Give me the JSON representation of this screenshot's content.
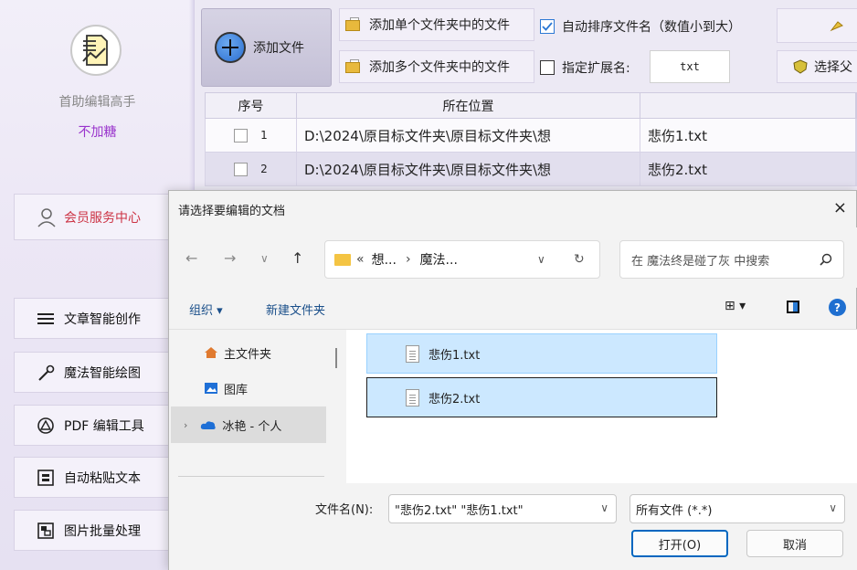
{
  "sidebar": {
    "app_name": "首助编辑高手",
    "app_subtitle": "不加糖",
    "member_center": "会员服务中心",
    "nav": [
      {
        "label": "文章智能创作",
        "icon": "menu-lines-icon"
      },
      {
        "label": "魔法智能绘图",
        "icon": "magic-wand-icon"
      },
      {
        "label": "PDF 编辑工具",
        "icon": "pdf-icon"
      },
      {
        "label": "自动粘贴文本",
        "icon": "paste-icon"
      },
      {
        "label": "图片批量处理",
        "icon": "image-icon"
      }
    ]
  },
  "toolbar": {
    "add_file": "添加文件",
    "add_single_folder": "添加单个文件夹中的文件",
    "add_multi_folder": "添加多个文件夹中的文件",
    "auto_sort": "自动排序文件名（数值小到大）",
    "auto_sort_checked": true,
    "specify_ext": "指定扩展名:",
    "specify_ext_checked": false,
    "ext_value": "txt",
    "select_parent": "选择父"
  },
  "table": {
    "headers": [
      "序号",
      "所在位置",
      ""
    ],
    "rows": [
      {
        "index": "1",
        "location": "D:\\2024\\原目标文件夹\\原目标文件夹\\想",
        "name": "悲伤1.txt"
      },
      {
        "index": "2",
        "location": "D:\\2024\\原目标文件夹\\原目标文件夹\\想",
        "name": "悲伤2.txt"
      }
    ]
  },
  "dialog": {
    "title": "请选择要编辑的文档",
    "close": "×",
    "path_part1": "想...",
    "path_part2": "魔法...",
    "search_placeholder": "在 魔法终是碰了灰 中搜索",
    "organize": "组织 ▾",
    "new_folder": "新建文件夹",
    "tree": [
      {
        "label": "主文件夹",
        "icon": "home-icon"
      },
      {
        "label": "图库",
        "icon": "gallery-icon"
      },
      {
        "label": "冰艳 - 个人",
        "icon": "cloud-icon"
      }
    ],
    "files": [
      "悲伤1.txt",
      "悲伤2.txt"
    ],
    "filename_label": "文件名(N):",
    "filename_value": "\"悲伤2.txt\" \"悲伤1.txt\"",
    "filetype": "所有文件 (*.*)",
    "open": "打开(O)",
    "cancel": "取消"
  },
  "colors": {
    "accent": "#0067c0",
    "selection": "#cce8ff",
    "subtitle": "#9933cc",
    "member": "#cc3344"
  }
}
